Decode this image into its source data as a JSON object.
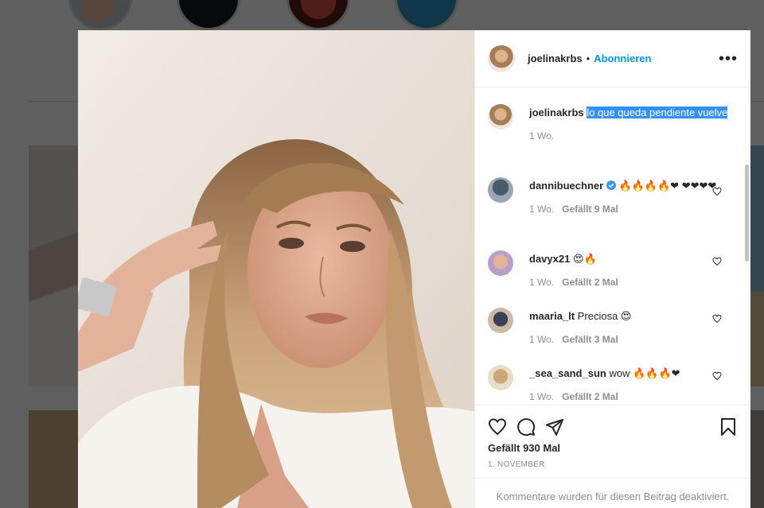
{
  "post": {
    "username": "joelinakrbs",
    "separator": "•",
    "follow_label": "Abonnieren",
    "more_icon": "more-icon",
    "caption": {
      "username": "joelinakrbs",
      "text": "lo que queda pendiente vuelve",
      "time": "1 Wo."
    },
    "comments": [
      {
        "username": "dannibuechner",
        "verified": true,
        "text": "🔥🔥🔥🔥❤ ❤❤❤❤",
        "time": "1 Wo.",
        "likes": "Gefällt 9 Mal"
      },
      {
        "username": "davyx21",
        "verified": false,
        "text": "😍🔥",
        "time": "1 Wo.",
        "likes": "Gefällt 2 Mal"
      },
      {
        "username": "maaria_lt",
        "verified": false,
        "text": "Preciosa 😍",
        "time": "1 Wo.",
        "likes": "Gefällt 3 Mal"
      },
      {
        "username": "_sea_sand_sun",
        "verified": false,
        "text": "wow 🔥🔥🔥❤",
        "time": "1 Wo.",
        "likes": "Gefällt 2 Mal"
      }
    ],
    "likes_total": "Gefällt 930 Mal",
    "date": "1. NOVEMBER",
    "comments_disabled": "Kommentare wurden für diesen Beitrag deaktiviert."
  },
  "colors": {
    "accent": "#0095f6",
    "selection": "#3391ff",
    "verified": "#3897f0",
    "muted": "#8e8e8e"
  }
}
